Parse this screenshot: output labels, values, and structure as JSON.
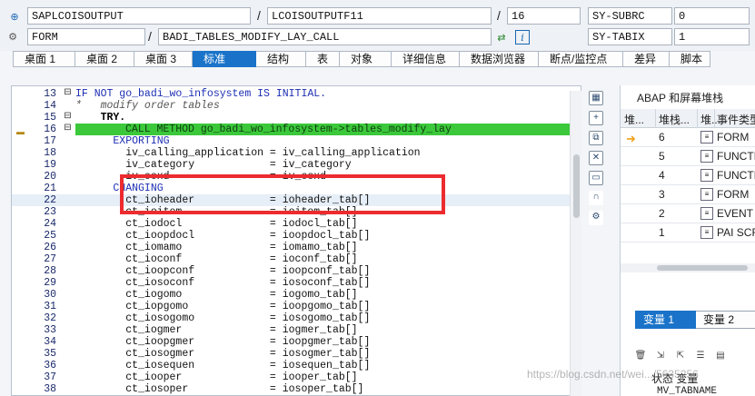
{
  "header": {
    "row1": {
      "program": "SAPLCOISOUTPUT",
      "include": "LCOISOUTPUTF11",
      "line": "16",
      "sysvar_name": "SY-SUBRC",
      "sysvar_value": "0"
    },
    "row2": {
      "event_type": "FORM",
      "event_name": "BADI_TABLES_MODIFY_LAY_CALL",
      "sysvar_name": "SY-TABIX",
      "sysvar_value": "1"
    },
    "separator": "/"
  },
  "tabs": [
    "桌面 1",
    "桌面 2",
    "桌面 3",
    "标准",
    "结构",
    "表",
    "对象",
    "详细信息",
    "数据浏览器",
    "断点/监控点",
    "差异",
    "脚本"
  ],
  "active_tab": "标准",
  "code_lines": [
    {
      "n": "13",
      "code": "IF NOT go_badi_wo_infosystem IS INITIAL."
    },
    {
      "n": "14",
      "code": "*   modify order tables"
    },
    {
      "n": "15",
      "code": "    TRY."
    },
    {
      "n": "16",
      "code": "CALL METHOD go_badi_wo_infosystem->tables_modify_lay"
    },
    {
      "n": "17",
      "code": "      EXPORTING"
    },
    {
      "n": "18",
      "code": "        iv_calling_application = iv_calling_application"
    },
    {
      "n": "19",
      "code": "        iv_category            = iv_category"
    },
    {
      "n": "20",
      "code": "        iv_ooxd                = iv_ooxd"
    },
    {
      "n": "21",
      "code": "      CHANGING"
    },
    {
      "n": "22",
      "code": "        ct_ioheader            = ioheader_tab[]"
    },
    {
      "n": "23",
      "code": "        ct_ioitem              = ioitem_tab[]"
    },
    {
      "n": "24",
      "code": "        ct_iodocl              = iodocl_tab[]"
    },
    {
      "n": "25",
      "code": "        ct_ioopdocl            = ioopdocl_tab[]"
    },
    {
      "n": "26",
      "code": "        ct_iomamo              = iomamo_tab[]"
    },
    {
      "n": "27",
      "code": "        ct_ioconf              = ioconf_tab[]"
    },
    {
      "n": "28",
      "code": "        ct_ioopconf            = ioopconf_tab[]"
    },
    {
      "n": "29",
      "code": "        ct_iosoconf            = iosoconf_tab[]"
    },
    {
      "n": "30",
      "code": "        ct_iogomo              = iogomo_tab[]"
    },
    {
      "n": "31",
      "code": "        ct_iopgomo             = ioopgomo_tab[]"
    },
    {
      "n": "32",
      "code": "        ct_iosogomo            = iosogomo_tab[]"
    },
    {
      "n": "33",
      "code": "        ct_iogmer              = iogmer_tab[]"
    },
    {
      "n": "34",
      "code": "        ct_ioopgmer            = ioopgmer_tab[]"
    },
    {
      "n": "35",
      "code": "        ct_iosogmer            = iosogmer_tab[]"
    },
    {
      "n": "36",
      "code": "        ct_iosequen            = iosequen_tab[]"
    },
    {
      "n": "37",
      "code": "        ct_iooper              = iooper_tab[]"
    },
    {
      "n": "38",
      "code": "        ct_iosoper             = iosoper_tab[]"
    }
  ],
  "current_line": "16",
  "abap_stack": {
    "title": "ABAP 和屏幕堆栈",
    "columns": [
      "堆...",
      "堆栈...",
      "堆...",
      "事件类型"
    ],
    "rows": [
      {
        "level": "6",
        "event": "FORM",
        "current": true
      },
      {
        "level": "5",
        "event": "FUNCTION",
        "current": false
      },
      {
        "level": "4",
        "event": "FUNCTION",
        "current": false
      },
      {
        "level": "3",
        "event": "FORM",
        "current": false
      },
      {
        "level": "2",
        "event": "EVENT",
        "current": false
      },
      {
        "level": "1",
        "event": "PAI SCR",
        "current": false
      }
    ]
  },
  "variables": {
    "tabs": [
      "变量 1",
      "变量 2"
    ],
    "active_tab": "变量 1",
    "column_headers": [
      "状态",
      "变量"
    ],
    "first_row": "MV_TABNAME"
  },
  "watermark": "https://blog.csdn.net/wei.../5635256"
}
